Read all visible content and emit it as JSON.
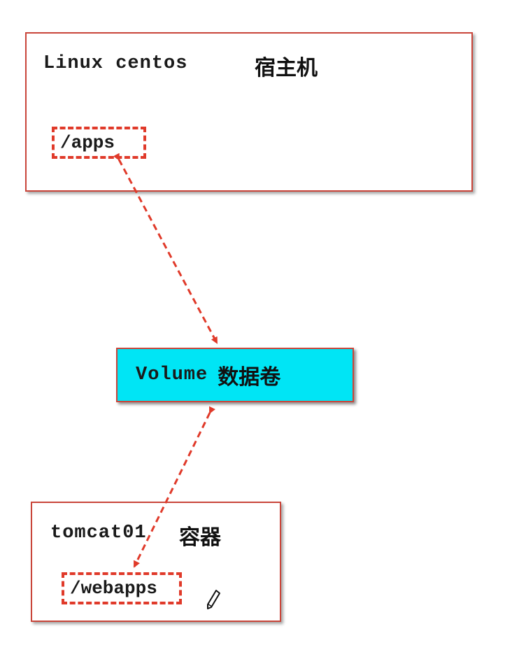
{
  "host": {
    "title": "Linux centos",
    "subtitle": "宿主机",
    "path": "/apps"
  },
  "volume": {
    "label": "Volume",
    "subtitle": "数据卷"
  },
  "container": {
    "title": "tomcat01",
    "subtitle": "容器",
    "path": "/webapps"
  },
  "colors": {
    "border": "#c9453a",
    "dashed": "#e03a2a",
    "volume_fill": "#00e5f5"
  },
  "icons": [
    "pencil-icon"
  ]
}
